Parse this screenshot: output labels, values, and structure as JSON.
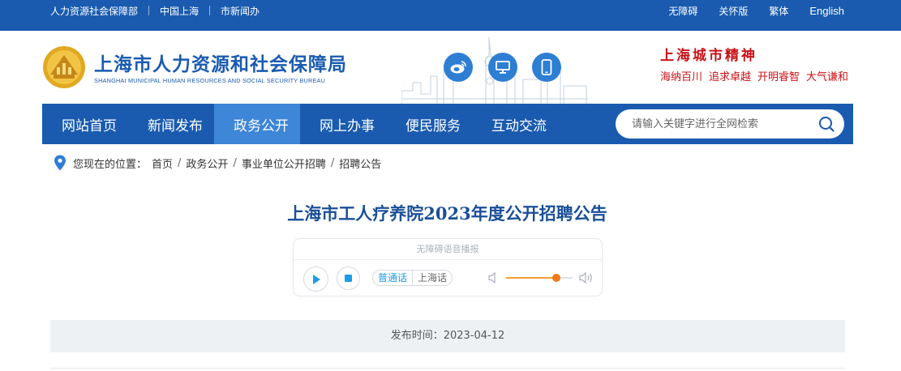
{
  "topbar": {
    "left_links": [
      "人力资源社会保障部",
      "中国上海",
      "市新闻办"
    ],
    "right_links": [
      "无障碍",
      "关怀版",
      "繁体",
      "English"
    ]
  },
  "header": {
    "title": "上海市人力资源和社会保障局",
    "subtitle": "SHANGHAI MUNICIPAL HUMAN RESOURCES AND SOCIAL SECURITY BUREAU",
    "icons": [
      "weibo-icon",
      "computer-icon",
      "mobile-icon"
    ],
    "spirit_title": "上海城市精神",
    "spirit_items": [
      "海纳百川",
      "追求卓越",
      "开明睿智",
      "大气谦和"
    ]
  },
  "nav": {
    "items": [
      "网站首页",
      "新闻发布",
      "政务公开",
      "网上办事",
      "便民服务",
      "互动交流"
    ],
    "active_index": 2,
    "search_placeholder": "请输入关键字进行全网检索"
  },
  "breadcrumb": {
    "label": "您现在的位置：",
    "items": [
      "首页",
      "政务公开",
      "事业单位公开招聘",
      "招聘公告"
    ]
  },
  "article": {
    "title": "上海市工人疗养院2023年度公开招聘公告",
    "publish_time": "发布时间：2023-04-12"
  },
  "audio": {
    "title": "无障碍语音播报",
    "lang_selected": "普通话",
    "lang_other": "上海话",
    "volume_fraction": 0.76
  },
  "colors": {
    "primary": "#1a5bb0",
    "nav_active": "#3d86d8",
    "spirit_red": "#c91218",
    "audio_blue": "#1e9be8",
    "volume_orange": "#f07818"
  }
}
